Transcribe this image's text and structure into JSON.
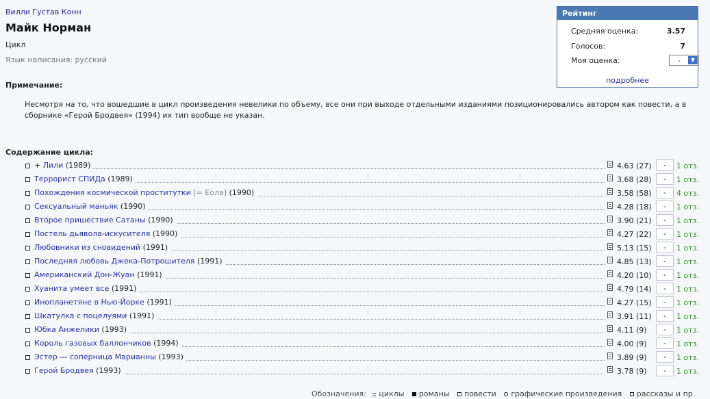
{
  "author": "Вилли Густав Конн",
  "title": "Майк Норман",
  "work_type": "Цикл",
  "language": "Язык написания: русский",
  "note": {
    "heading": "Примечание:",
    "text": "Несмотря на то, что вошедшие в цикл произведения невелики по объему, все они при выходе отдельными изданиями позиционировались автором как повести, а в сборнике «Герой Бродвея» (1994) их тип вообще не указан."
  },
  "rating": {
    "heading": "Рейтинг",
    "avg_label": "Средняя оценка:",
    "avg_value": "3.57",
    "votes_label": "Голосов:",
    "votes_value": "7",
    "my_label": "Моя оценка:",
    "my_value": "-",
    "more_link": "подробнее"
  },
  "contents_heading": "Содержание цикла:",
  "items": [
    {
      "prefix": "+ ",
      "title": "Лили",
      "alt": "",
      "year": "(1989)",
      "score": "4.63 (27)",
      "vote": "-",
      "reviews": "1 отз."
    },
    {
      "prefix": "",
      "title": "Террорист СПИДа",
      "alt": "",
      "year": "(1989)",
      "score": "3.68 (28)",
      "vote": "-",
      "reviews": "1 отз."
    },
    {
      "prefix": "",
      "title": "Похождения космической проститутки",
      "alt": "[= Еола]",
      "year": "(1990)",
      "score": "3.58 (58)",
      "vote": "-",
      "reviews": "4 отз."
    },
    {
      "prefix": "",
      "title": "Сексуальный маньяк",
      "alt": "",
      "year": "(1990)",
      "score": "4.28 (18)",
      "vote": "-",
      "reviews": "1 отз."
    },
    {
      "prefix": "",
      "title": "Второе пришествие Сатаны",
      "alt": "",
      "year": "(1990)",
      "score": "3.90 (21)",
      "vote": "-",
      "reviews": "1 отз."
    },
    {
      "prefix": "",
      "title": "Постель дьявола-искусителя",
      "alt": "",
      "year": "(1990)",
      "score": "4.27 (22)",
      "vote": "-",
      "reviews": "1 отз."
    },
    {
      "prefix": "",
      "title": "Любовники из сновидений",
      "alt": "",
      "year": "(1991)",
      "score": "5.13 (15)",
      "vote": "-",
      "reviews": "1 отз."
    },
    {
      "prefix": "",
      "title": "Последняя любовь Джека-Потрошителя",
      "alt": "",
      "year": "(1991)",
      "score": "4.85 (13)",
      "vote": "-",
      "reviews": "1 отз."
    },
    {
      "prefix": "",
      "title": "Американский Дон-Жуан",
      "alt": "",
      "year": "(1991)",
      "score": "4.20 (10)",
      "vote": "-",
      "reviews": "1 отз."
    },
    {
      "prefix": "",
      "title": "Хуанита умеет все",
      "alt": "",
      "year": "(1991)",
      "score": "4.79 (14)",
      "vote": "-",
      "reviews": "1 отз."
    },
    {
      "prefix": "",
      "title": "Инопланетяне в Нью-Йорке",
      "alt": "",
      "year": "(1991)",
      "score": "4.27 (15)",
      "vote": "-",
      "reviews": "1 отз."
    },
    {
      "prefix": "",
      "title": "Шкатулка с поцелуями",
      "alt": "",
      "year": "(1991)",
      "score": "3.91 (11)",
      "vote": "-",
      "reviews": "1 отз."
    },
    {
      "prefix": "",
      "title": "Юбка Анжелики",
      "alt": "",
      "year": "(1993)",
      "score": "4.11 (9)",
      "vote": "-",
      "reviews": "1 отз."
    },
    {
      "prefix": "",
      "title": "Король газовых баллончиков",
      "alt": "",
      "year": "(1994)",
      "score": "4.00 (9)",
      "vote": "-",
      "reviews": "1 отз."
    },
    {
      "prefix": "",
      "title": "Эстер — соперница Марианны",
      "alt": "",
      "year": "(1993)",
      "score": "3.89 (9)",
      "vote": "-",
      "reviews": "1 отз."
    },
    {
      "prefix": "",
      "title": "Герой Бродвея",
      "alt": "",
      "year": "(1993)",
      "score": "3.78 (9)",
      "vote": "-",
      "reviews": "1 отз."
    }
  ],
  "legend": {
    "label": "Обозначения:",
    "items": [
      {
        "icon": "cycle-icon",
        "text": "циклы"
      },
      {
        "icon": "novel-icon",
        "text": "романы"
      },
      {
        "icon": "novella-icon",
        "text": "повести"
      },
      {
        "icon": "graphic-icon",
        "text": "графические произведения"
      },
      {
        "icon": "story-icon",
        "text": "рассказы и пр"
      }
    ]
  }
}
